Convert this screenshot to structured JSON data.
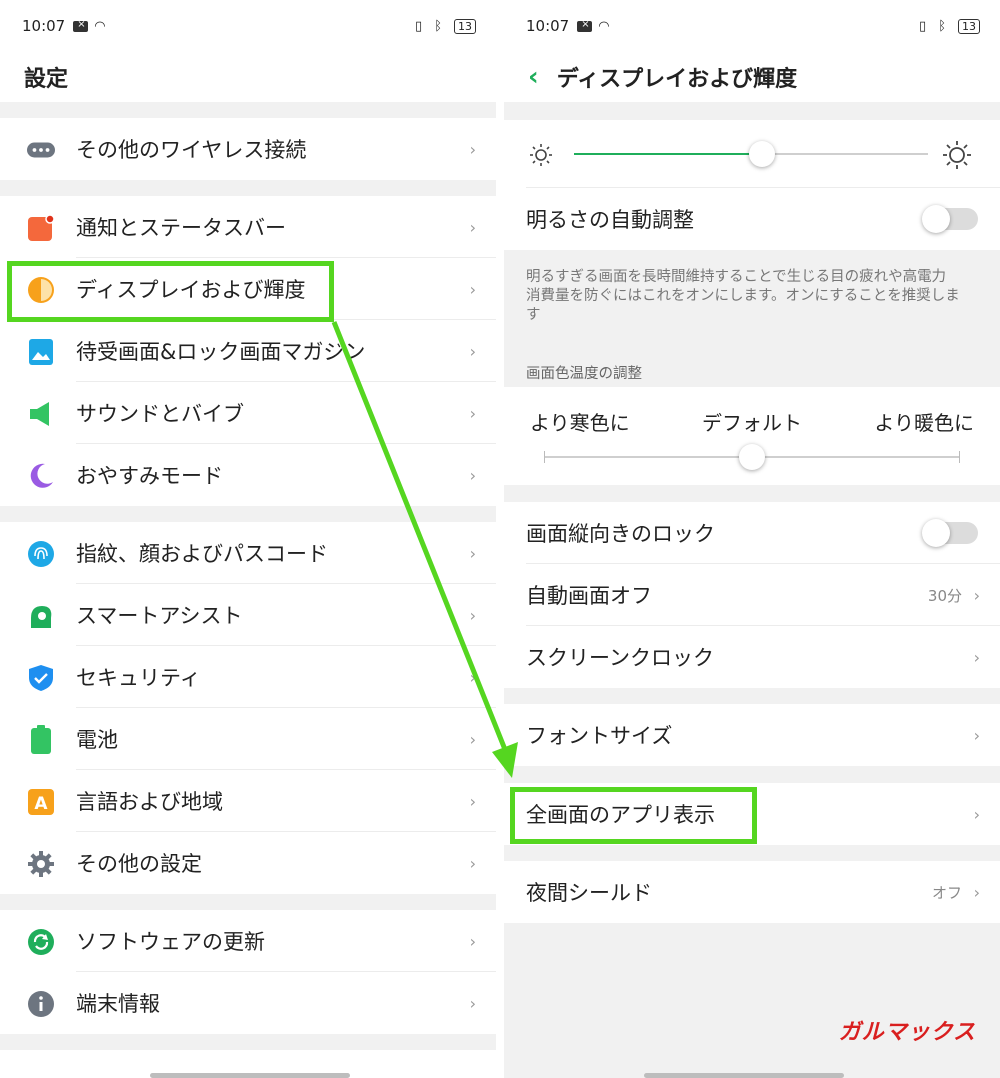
{
  "status_bar": {
    "time": "10:07",
    "battery": "13"
  },
  "left": {
    "title": "設定",
    "sections": [
      {
        "items": [
          {
            "label": "その他のワイヤレス接続",
            "icon": "more-dots-icon",
            "color": "#6d7580"
          }
        ]
      },
      {
        "items": [
          {
            "label": "通知とステータスバー",
            "icon": "notification-icon",
            "color": "#f4683c"
          },
          {
            "label": "ディスプレイおよび輝度",
            "icon": "display-brightness-icon",
            "color": "#f7a11b"
          },
          {
            "label": "待受画面&ロック画面マガジン",
            "icon": "wallpaper-icon",
            "color": "#1ea8e6"
          },
          {
            "label": "サウンドとバイブ",
            "icon": "speaker-icon",
            "color": "#33c463"
          },
          {
            "label": "おやすみモード",
            "icon": "moon-icon",
            "color": "#9a5be3"
          }
        ]
      },
      {
        "items": [
          {
            "label": "指紋、顔およびパスコード",
            "icon": "fingerprint-icon",
            "color": "#1ea8e6"
          },
          {
            "label": "スマートアシスト",
            "icon": "smart-assist-icon",
            "color": "#1fae5b"
          },
          {
            "label": "セキュリティ",
            "icon": "shield-icon",
            "color": "#1e8ff0"
          },
          {
            "label": "電池",
            "icon": "battery-icon",
            "color": "#33c463"
          },
          {
            "label": "言語および地域",
            "icon": "language-icon",
            "color": "#f7a11b"
          },
          {
            "label": "その他の設定",
            "icon": "gear-icon",
            "color": "#6d7580"
          }
        ]
      },
      {
        "items": [
          {
            "label": "ソフトウェアの更新",
            "icon": "update-icon",
            "color": "#1fae5b"
          },
          {
            "label": "端末情報",
            "icon": "info-icon",
            "color": "#6d7580"
          }
        ]
      }
    ]
  },
  "right": {
    "title": "ディスプレイおよび輝度",
    "brightness_level": 0.53,
    "auto_brightness_label": "明るさの自動調整",
    "auto_brightness_description": "明るすぎる画面を長時間維持することで生じる目の疲れや高電力消費量を防ぐにはこれをオンにします。オンにすることを推奨します",
    "color_temp_header": "画面色温度の調整",
    "color_temp": {
      "cool": "より寒色に",
      "default": "デフォルト",
      "warm": "より暖色に",
      "level": 0.5
    },
    "rotation_lock_label": "画面縦向きのロック",
    "auto_screen_off_label": "自動画面オフ",
    "auto_screen_off_value": "30分",
    "screen_clock_label": "スクリーンクロック",
    "font_size_label": "フォントサイズ",
    "fullscreen_apps_label": "全画面のアプリ表示",
    "night_shield_label": "夜間シールド",
    "night_shield_value": "オフ"
  },
  "watermark": "ガルマックス",
  "colors": {
    "highlight": "#55d620",
    "accent": "#1fae5b",
    "watermark": "#d91f1f"
  }
}
